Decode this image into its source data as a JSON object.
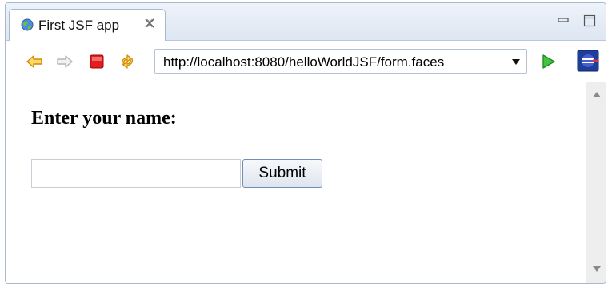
{
  "tab": {
    "title": "First JSF app"
  },
  "toolbar": {
    "url": "http://localhost:8080/helloWorldJSF/form.faces"
  },
  "page": {
    "heading": "Enter your name:",
    "name_input_value": "",
    "submit_label": "Submit"
  },
  "icons": {
    "tab": "globe-icon",
    "close": "close-icon",
    "back": "back-arrow-icon",
    "forward": "forward-arrow-icon",
    "stop": "stop-icon",
    "refresh": "refresh-icon",
    "go": "go-icon",
    "browser": "browser-icon"
  },
  "colors": {
    "stop": "#e02020",
    "back_arrow": "#f0a000",
    "go": "#2fa52f"
  }
}
